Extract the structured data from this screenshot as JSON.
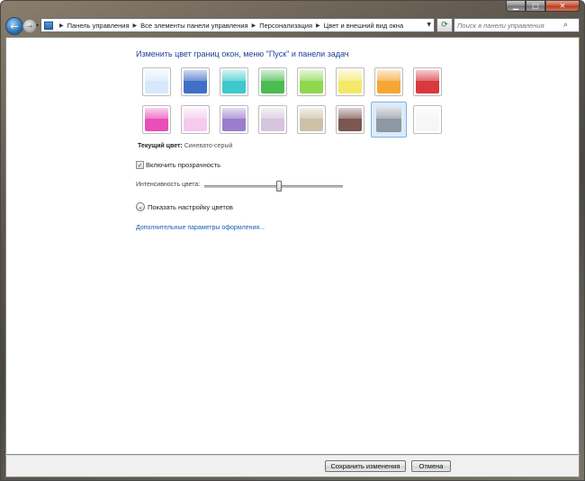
{
  "window": {
    "caption_min": "▁",
    "caption_max": "□",
    "caption_close": "✕"
  },
  "nav": {
    "back_glyph": "←",
    "forward_glyph": "→",
    "breadcrumb": [
      "Панель управления",
      "Все элементы панели управления",
      "Персонализация",
      "Цвет и внешний вид окна"
    ],
    "search_placeholder": "Поиск в панели управления"
  },
  "main": {
    "heading": "Изменить цвет границ окон, меню \"Пуск\" и панели задач",
    "swatches": [
      {
        "name": "sky",
        "color": "#d8e8fb"
      },
      {
        "name": "twilight",
        "color": "#3f6fc6"
      },
      {
        "name": "sea",
        "color": "#3fc9cc"
      },
      {
        "name": "leaf",
        "color": "#4cbb52"
      },
      {
        "name": "lime",
        "color": "#8fd84f"
      },
      {
        "name": "lemon",
        "color": "#f4e86a"
      },
      {
        "name": "pumpkin",
        "color": "#f6a634"
      },
      {
        "name": "ruby",
        "color": "#d9383e"
      },
      {
        "name": "fuchsia",
        "color": "#ea4fb7"
      },
      {
        "name": "blush",
        "color": "#f6c9ee"
      },
      {
        "name": "violet",
        "color": "#9b7dcc"
      },
      {
        "name": "lavender",
        "color": "#d6c4dc"
      },
      {
        "name": "taupe",
        "color": "#cdc1a8"
      },
      {
        "name": "chocolate",
        "color": "#7a5752"
      },
      {
        "name": "slate",
        "color": "#8d98a4",
        "selected": true
      },
      {
        "name": "frost",
        "color": "#f6f6f6"
      }
    ],
    "current_color_label": "Текущий цвет:",
    "current_color_value": "Синевато-серый",
    "transparency_checked": "✓",
    "transparency_label": "Включить прозрачность",
    "intensity_label": "Интенсивность цвета:",
    "intensity_fraction": 0.54,
    "show_settings_glyph": "⌄",
    "show_settings_label": "Показать настройку цветов",
    "advanced_link": "Дополнительные параметры оформления..."
  },
  "footer": {
    "save_label": "Сохранить изменения",
    "cancel_label": "Отмена"
  }
}
